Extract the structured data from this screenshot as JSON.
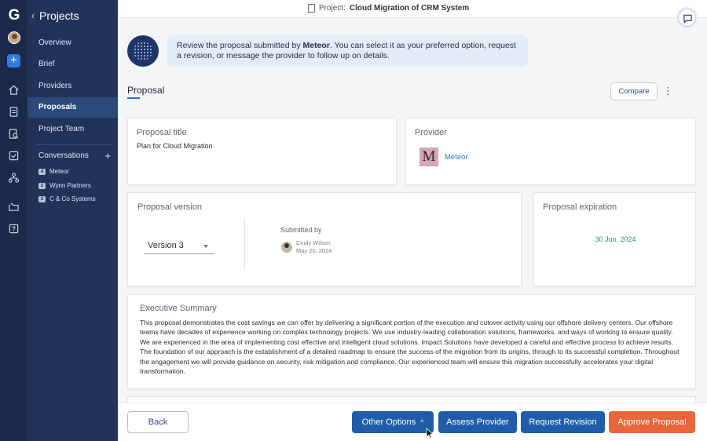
{
  "rail": {
    "logo": "G",
    "icons": [
      "home-icon",
      "document-icon",
      "search-document-icon",
      "checklist-icon",
      "org-chart-icon",
      "folder-icon",
      "help-icon"
    ]
  },
  "nav": {
    "back_chevron": "‹",
    "title": "Projects",
    "items": [
      {
        "label": "Overview",
        "active": false
      },
      {
        "label": "Brief",
        "active": false
      },
      {
        "label": "Providers",
        "active": false
      },
      {
        "label": "Proposals",
        "active": true
      },
      {
        "label": "Project Team",
        "active": false
      }
    ],
    "conversations_label": "Conversations",
    "conversations_add": "+",
    "conversations": [
      {
        "count": "4",
        "name": "Meteor"
      },
      {
        "count": "2",
        "name": "Wynn Partners"
      },
      {
        "count": "2",
        "name": "C & Co Systems"
      }
    ]
  },
  "topbar": {
    "project_prefix": "Project:",
    "project_name": "Cloud Migration of CRM System"
  },
  "banner": {
    "text_before": "Review the proposal submitted by ",
    "provider": "Meteor",
    "text_after": ". You can select it as your preferred option, request a revision, or message the provider to follow up on details."
  },
  "proposal": {
    "section_title": "Proposal",
    "compare_label": "Compare",
    "more_label": "⋮",
    "title_label": "Proposal title",
    "title_value": "Plan for Cloud Migration",
    "provider_label": "Provider",
    "provider_logo": "M",
    "provider_name": "Meteor",
    "version_label": "Proposal version",
    "version_value": "Version 3",
    "submitted_by_label": "Submitted by",
    "submitter_name": "Cindy Wilson",
    "submitted_date": "May 20, 2024",
    "expiration_label": "Proposal expiration",
    "expiration_date": "30 Jun, 2024",
    "summary_label": "Executive Summary",
    "summary_text": "This proposal demonstrates the cost savings we can offer by delivering a significant portion of the execution and cutover activity using our offshore delivery centers. Our offshore teams have decades of experience working on complex technology projects. We use industry-leading collaboration solutions, frameworks, and ways of working to ensure quality. We are experienced in the area of implementing cost effective and intelligent cloud solutions. Impact Solutions have developed a careful and effective process to achieve results. The foundation of our approach is the establishment of a detailed roadmap to ensure the success of the migration from its origins, through to its successful completion. Throughout the engagement we will provide guidance on security, risk mitigation and compliance. Our experienced team will ensure this migration successfully accelerates your digital transformation."
  },
  "footer": {
    "back": "Back",
    "other_options": "Other Options",
    "other_options_icon": "^",
    "assess": "Assess Provider",
    "request_revision": "Request Revision",
    "approve": "Approve Proposal"
  },
  "colors": {
    "rail": "#1b2a4a",
    "nav": "#22335a",
    "nav_active": "#2b4a7a",
    "primary_button": "#1f5da8",
    "approve_button": "#e8663a",
    "expiration_date": "#2f9a5e"
  }
}
